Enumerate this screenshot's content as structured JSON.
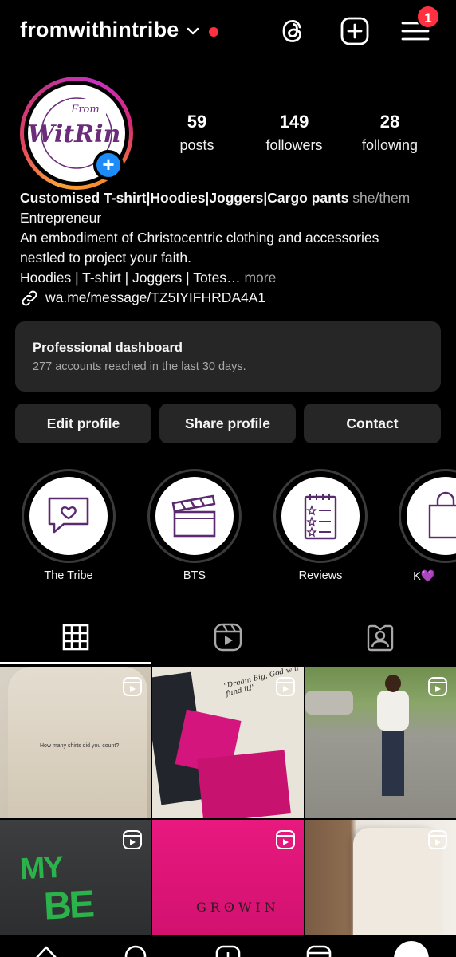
{
  "header": {
    "username": "fromwithintribe",
    "notification_count": "1",
    "icons": [
      "chevron-down-icon",
      "threads-icon",
      "create-plus-icon",
      "menu-icon"
    ]
  },
  "profile": {
    "avatar_logo_text": "WitRin",
    "avatar_logo_small": "From",
    "stats": [
      {
        "value": "59",
        "label": "posts"
      },
      {
        "value": "149",
        "label": "followers"
      },
      {
        "value": "28",
        "label": "following"
      }
    ],
    "name": "Customised T-shirt|Hoodies|Joggers|Cargo pants",
    "pronouns": "she/them",
    "category": "Entrepreneur",
    "bio_line1": "An embodiment of Christocentric clothing and accessories",
    "bio_line2": "nestled to project your faith.",
    "bio_line3": "Hoodies | T-shirt | Joggers | Totes",
    "bio_more_ellipsis": "…",
    "bio_more": " more",
    "link": "wa.me/message/TZ5IYIFHRDA4A1"
  },
  "dashboard": {
    "title": "Professional dashboard",
    "subtitle": "277 accounts reached in the last 30 days."
  },
  "buttons": {
    "edit": "Edit profile",
    "share": "Share profile",
    "contact": "Contact"
  },
  "highlights": [
    {
      "label": "The Tribe",
      "icon": "chat-heart-icon"
    },
    {
      "label": "BTS",
      "icon": "clapperboard-icon"
    },
    {
      "label": "Reviews",
      "icon": "checklist-icon"
    },
    {
      "label": "K💜",
      "icon": "shopping-bag-icon"
    }
  ],
  "posts": {
    "post1_text": "How many shirts did you count?",
    "post2_text": "\"Dream Big, God will fund it!\"",
    "post5_text": "GRʘWIN"
  },
  "colors": {
    "accent_red": "#ff3040",
    "accent_blue": "#1d8cf8",
    "highlight_purple": "#5b2a6e",
    "card_bg": "#262626"
  }
}
